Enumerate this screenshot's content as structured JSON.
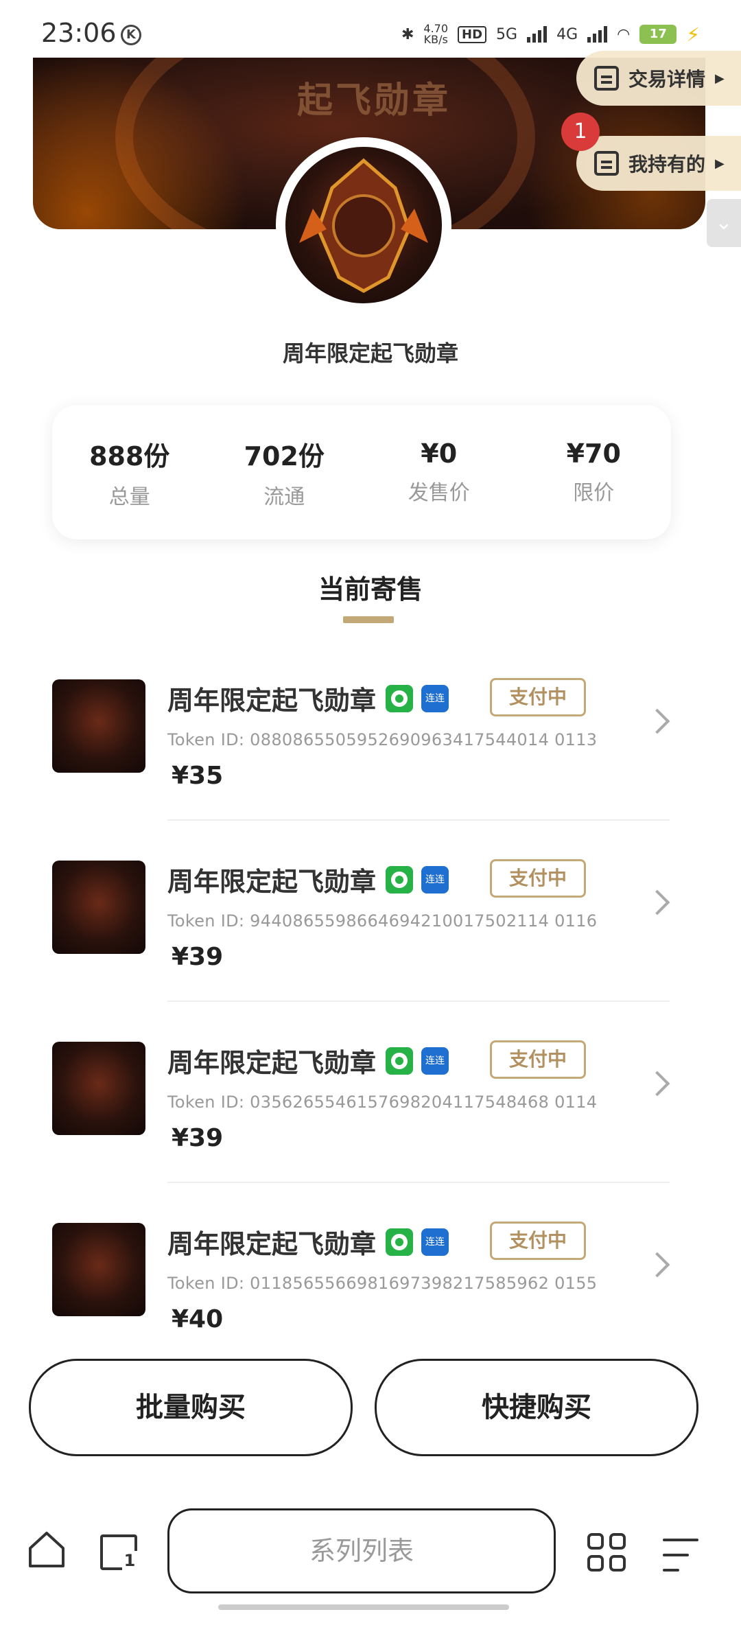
{
  "status_bar": {
    "time": "23:06",
    "k_badge": "K",
    "net_speed_value": "4.70",
    "net_speed_unit": "KB/s",
    "hd": "HD",
    "sim1": "5G",
    "sim2": "4G",
    "battery": "17"
  },
  "banner": {
    "text": "起飞勋章"
  },
  "side_menu": {
    "trade_detail": "交易详情",
    "my_holdings": "我持有的",
    "holdings_badge": "1"
  },
  "item_title": "周年限定起飞勋章",
  "stats": [
    {
      "value": "888份",
      "label": "总量"
    },
    {
      "value": "702份",
      "label": "流通"
    },
    {
      "value": "¥0",
      "label": "发售价"
    },
    {
      "value": "¥70",
      "label": "限价"
    }
  ],
  "section_title": "当前寄售",
  "listings": [
    {
      "name": "周年限定起飞勋章",
      "status": "支付中",
      "token": "Token ID: 0880865505952690963417544014 0113",
      "price": "¥35"
    },
    {
      "name": "周年限定起飞勋章",
      "status": "支付中",
      "token": "Token ID: 9440865598664694210017502114 0116",
      "price": "¥39"
    },
    {
      "name": "周年限定起飞勋章",
      "status": "支付中",
      "token": "Token ID: 0356265546157698204117548468 0114",
      "price": "¥39"
    },
    {
      "name": "周年限定起飞勋章",
      "status": "支付中",
      "token": "Token ID: 0118565566981697398217585962 0155",
      "price": "¥40"
    }
  ],
  "chip_label": "连连",
  "buttons": {
    "batch_buy": "批量购买",
    "quick_buy": "快捷购买"
  },
  "bottom_nav": {
    "series_list": "系列列表",
    "tabs_count": "1"
  }
}
